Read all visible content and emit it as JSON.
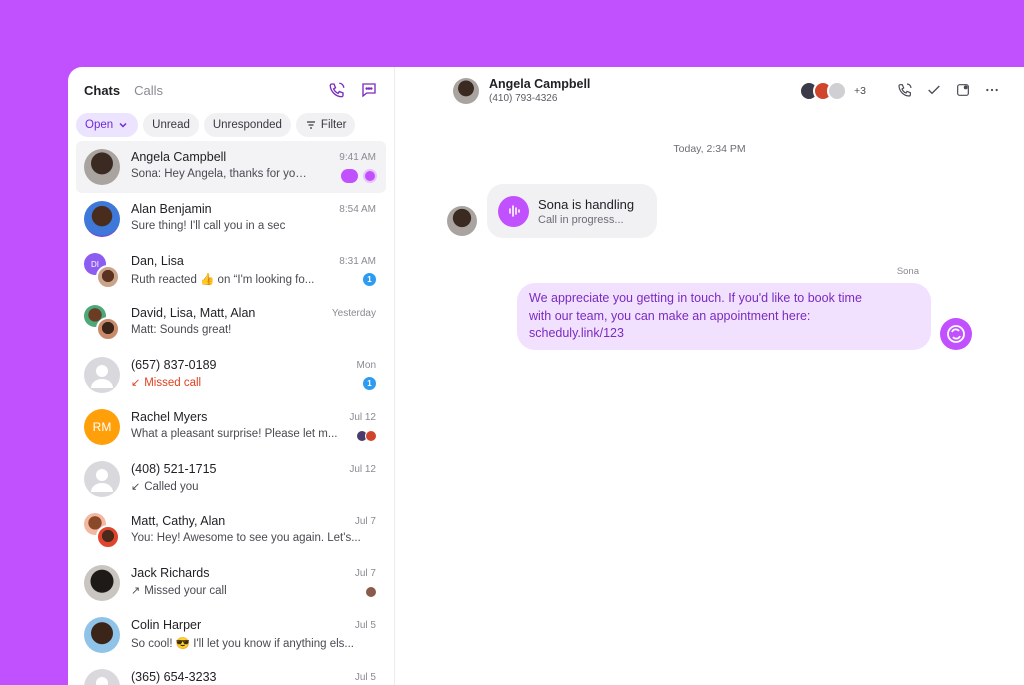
{
  "sidebar": {
    "tabs": [
      {
        "label": "Chats"
      },
      {
        "label": "Calls"
      }
    ],
    "filters": [
      {
        "label": "Open"
      },
      {
        "label": "Unread"
      },
      {
        "label": "Unresponded"
      },
      {
        "label": "Filter"
      }
    ],
    "chats": [
      {
        "name": "Angela Campbell",
        "time": "9:41 AM",
        "preview": "Sona: Hey Angela, thanks for your m..."
      },
      {
        "name": "Alan Benjamin",
        "time": "8:54 AM",
        "preview": "Sure thing! I'll call you in a sec"
      },
      {
        "name": "Dan, Lisa",
        "time": "8:31 AM",
        "preview": "Ruth reacted 👍 on “I'm looking fo...",
        "badge": "1",
        "initials": "DI"
      },
      {
        "name": "David, Lisa, Matt, Alan",
        "time": "Yesterday",
        "preview": "Matt: Sounds great!"
      },
      {
        "name": "(657) 837-0189",
        "time": "Mon",
        "preview": "Missed call",
        "badge": "1"
      },
      {
        "name": "Rachel Myers",
        "time": "Jul 12",
        "preview": "What a pleasant surprise! Please let m...",
        "initials": "RM"
      },
      {
        "name": "(408) 521-1715",
        "time": "Jul 12",
        "preview": "Called you"
      },
      {
        "name": "Matt, Cathy, Alan",
        "time": "Jul 7",
        "preview": "You: Hey! Awesome to see you again. Let's..."
      },
      {
        "name": "Jack Richards",
        "time": "Jul 7",
        "preview": "Missed your call"
      },
      {
        "name": "Colin Harper",
        "time": "Jul 5",
        "preview": "So cool! 😎 I'll let you know if anything els..."
      },
      {
        "name": "(365) 654-3233",
        "time": "Jul 5",
        "preview": ""
      }
    ]
  },
  "conversation": {
    "contact_name": "Angela Campbell",
    "contact_phone": "(410) 793-4326",
    "participants_more": "+3",
    "day_separator": "Today, 2:34 PM",
    "handler_title": "Sona is handling",
    "handler_subtitle": "Call in progress...",
    "sender": "Sona",
    "message_lines": [
      "We appreciate you getting in touch. If you'd like to book time",
      "with our team, you can make an appointment here:",
      "scheduly.link/123"
    ]
  },
  "colors": {
    "brand": "#c151ff",
    "accent": "#6f2bd8",
    "missed": "#e0401f",
    "badge": "#2d9bf0"
  }
}
